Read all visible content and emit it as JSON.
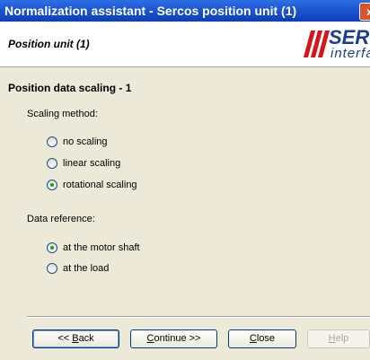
{
  "window": {
    "title": "Normalization assistant - Sercos position unit (1)",
    "close_symbol": "x"
  },
  "header": {
    "subtitle": "Position unit (1)",
    "logo": {
      "word": "SERCO",
      "sub": "interfac",
      "icon": "sercos-logo"
    }
  },
  "page": {
    "section_title": "Position data scaling - 1",
    "scaling": {
      "label": "Scaling method:",
      "options": [
        {
          "label": "no scaling",
          "checked": false
        },
        {
          "label": "linear scaling",
          "checked": false
        },
        {
          "label": "rotational scaling",
          "checked": true
        }
      ]
    },
    "reference": {
      "label": "Data reference:",
      "options": [
        {
          "label": "at the motor shaft",
          "checked": true
        },
        {
          "label": "at the load",
          "checked": false
        }
      ]
    }
  },
  "buttons": {
    "back": {
      "prefix": "<< ",
      "mnemonic": "B",
      "rest": "ack"
    },
    "continue": {
      "mnemonic": "C",
      "rest": "ontinue >>"
    },
    "close": {
      "mnemonic": "C",
      "rest": "lose"
    },
    "help": {
      "mnemonic": "H",
      "rest": "elp",
      "enabled": false
    }
  },
  "colors": {
    "title_blue": "#0b3fb9",
    "logo_red": "#d5141b",
    "logo_blue": "#1a3d8f",
    "dialog_bg": "#ece9d8",
    "radio_check_green": "#21a121"
  }
}
